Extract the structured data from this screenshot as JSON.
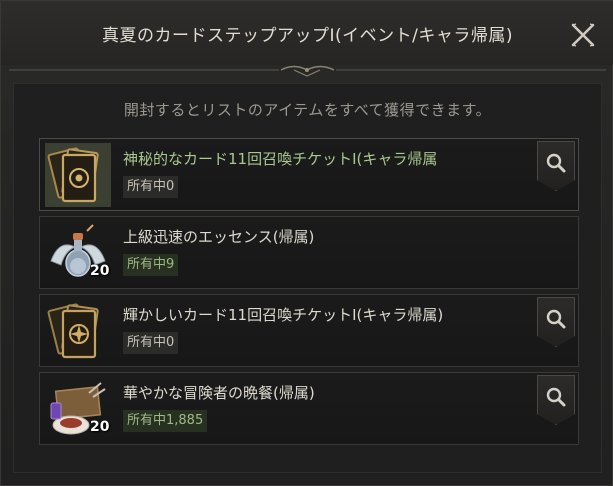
{
  "dialog": {
    "title": "真夏のカードステップアップⅠ(イベント/キャラ帰属)",
    "description": "開封するとリストのアイテムをすべて獲得できます。"
  },
  "items": [
    {
      "name": "神秘的なカード11回召喚チケットⅠ(キャラ帰属",
      "owned": "所有中0",
      "quantity": "",
      "name_color": "#a9c98e",
      "has_search": true,
      "icon": "mystic-card-ticket-icon"
    },
    {
      "name": "上級迅速のエッセンス(帰属)",
      "owned": "所有中9",
      "quantity": "20",
      "name_color": "#dedad0",
      "has_search": false,
      "icon": "swift-essence-icon"
    },
    {
      "name": "輝かしいカード11回召喚チケットⅠ(キャラ帰属)",
      "owned": "所有中0",
      "quantity": "",
      "name_color": "#dedad0",
      "has_search": true,
      "icon": "radiant-card-ticket-icon"
    },
    {
      "name": "華やかな冒険者の晩餐(帰属)",
      "owned": "所有中1,885",
      "quantity": "20",
      "name_color": "#dedad0",
      "has_search": true,
      "icon": "adventurer-dinner-icon"
    }
  ]
}
